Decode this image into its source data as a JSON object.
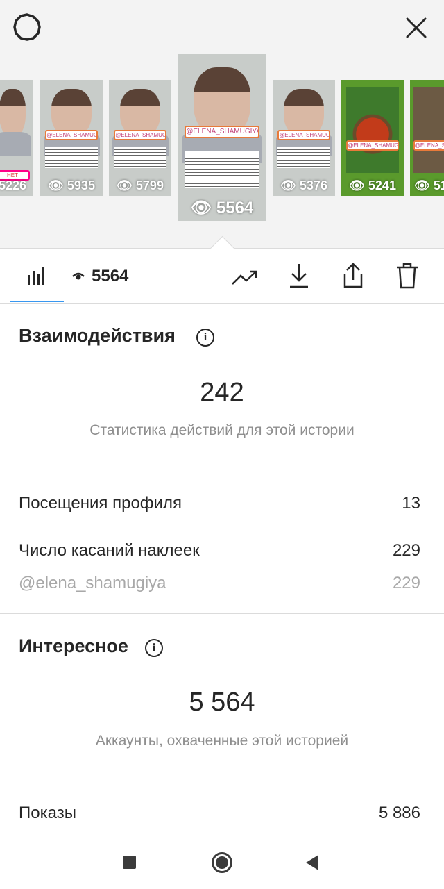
{
  "header": {
    "settings_icon": "gear-icon",
    "close_icon": "close-icon"
  },
  "stories": [
    {
      "views": "5226",
      "tag": "НЕТ"
    },
    {
      "views": "5935",
      "tag": "@ELENA_SHAMUGIYA"
    },
    {
      "views": "5799",
      "tag": "@ELENA_SHAMUGIYA"
    },
    {
      "views": "5564",
      "tag": "@ELENA_SHAMUGIYA",
      "selected": true
    },
    {
      "views": "5376",
      "tag": "@ELENA_SHAMUGIYA"
    },
    {
      "views": "5241",
      "tag": "@ELENA_SHAMUGIYA"
    },
    {
      "views": "51",
      "tag": "@ELENA_SHA"
    }
  ],
  "toolbar": {
    "views": "5564"
  },
  "interactions": {
    "title": "Взаимодействия",
    "total": "242",
    "caption": "Статистика действий для этой истории",
    "profile_visits_label": "Посещения профиля",
    "profile_visits_value": "13",
    "sticker_taps_label": "Число касаний наклеек",
    "sticker_taps_value": "229",
    "sticker_account_label": "@elena_shamugiya",
    "sticker_account_value": "229"
  },
  "discovery": {
    "title": "Интересное",
    "total": "5 564",
    "caption": "Аккаунты, охваченные этой историей",
    "impressions_label": "Показы",
    "impressions_value": "5 886"
  }
}
